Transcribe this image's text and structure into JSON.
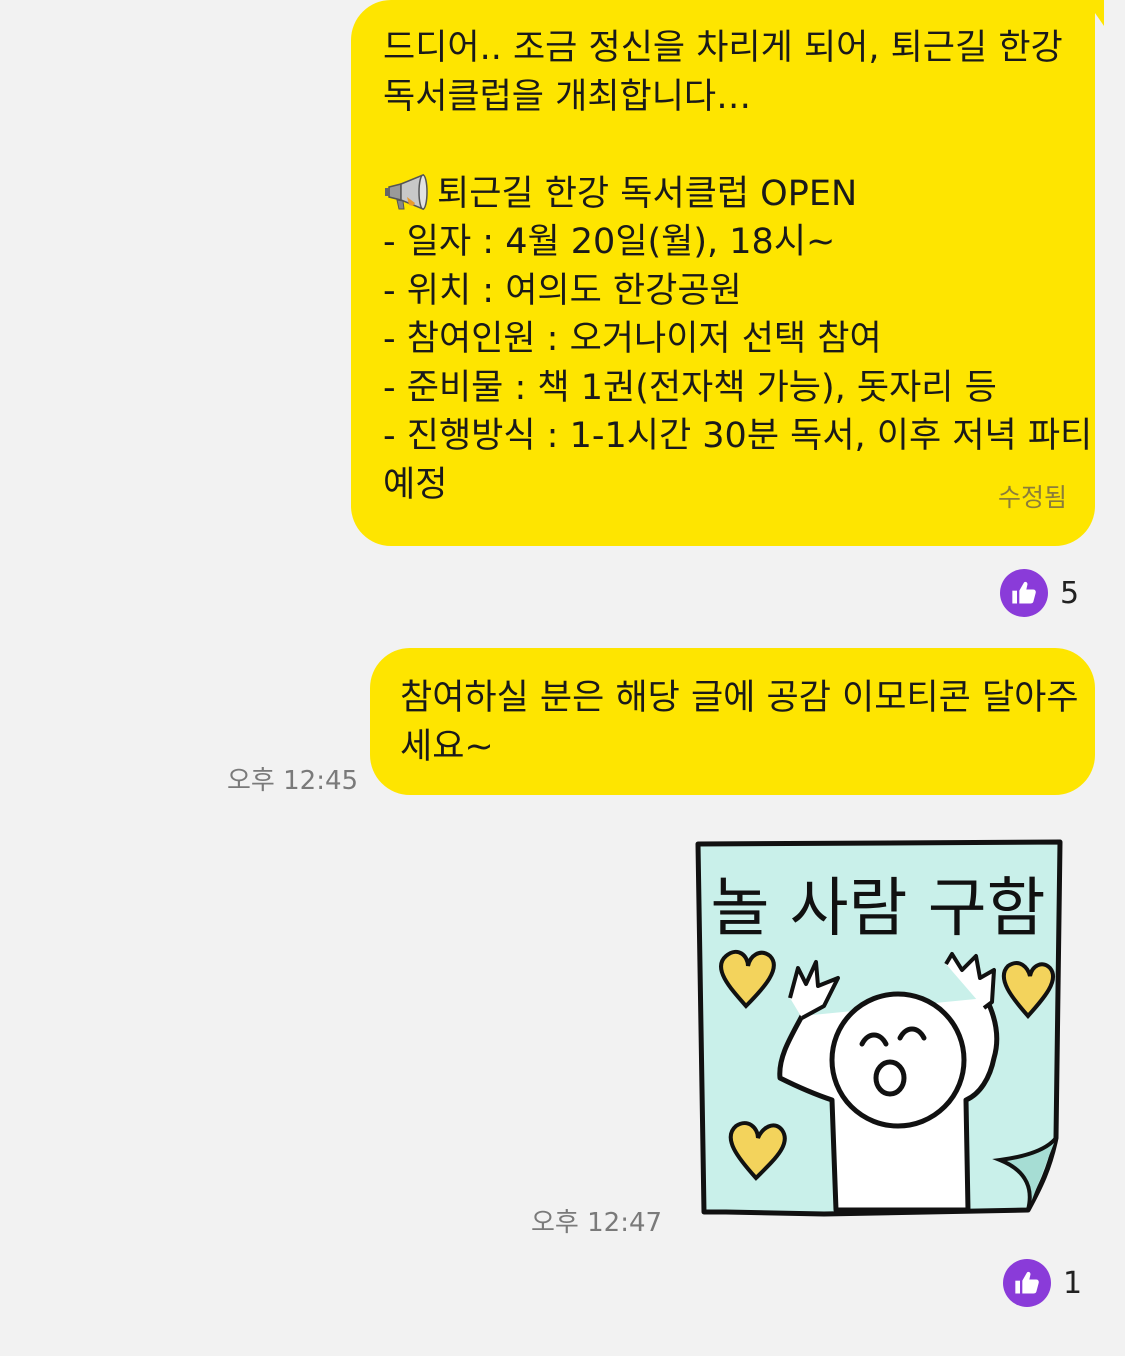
{
  "colors": {
    "bubble": "#fee500",
    "background": "#f2f2f2",
    "like": "#8a3bd9",
    "sticker_paper": "#c9f0ea",
    "sticker_heart": "#f3d35c"
  },
  "messages": {
    "first": {
      "lines": [
        "드디어.. 조금 정신을 차리게 되어, 퇴근길 한강",
        "독서클럽을 개최합니다…",
        "",
        "퇴근길 한강 독서클럽 OPEN",
        "- 일자 : 4월 20일(월), 18시~",
        "- 위치 : 여의도 한강공원",
        "- 참여인원 : 오거나이저 선택 참여",
        "- 준비물 : 책 1권(전자책 가능), 돗자리 등",
        "- 진행방식 : 1-1시간 30분 독서, 이후 저녁 파티",
        "예정"
      ],
      "megaphone_icon": "megaphone-icon",
      "edited_label": "수정됨",
      "reaction_count": "5"
    },
    "second": {
      "lines": [
        "참여하실 분은 해당 글에 공감 이모티콘 달아주",
        "세요~"
      ],
      "time": "오후 12:45"
    },
    "sticker": {
      "text": "놀 사람 구함",
      "time": "오후 12:47",
      "reaction_count": "1"
    }
  }
}
